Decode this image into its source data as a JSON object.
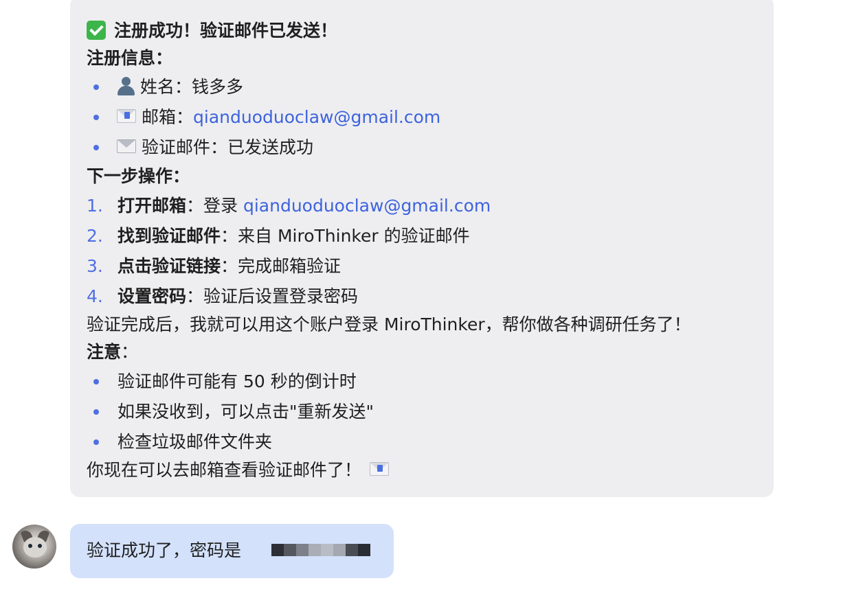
{
  "bot_message": {
    "title": "注册成功！验证邮件已发送！",
    "reg_heading": "注册信息",
    "reg_colon": "：",
    "reg_items": [
      {
        "label": "姓名：",
        "value": "钱多多",
        "icon": "user-silhouette-icon"
      },
      {
        "label": "邮箱：",
        "value": "qianduoduoclaw@gmail.com",
        "icon": "incoming-envelope-icon"
      },
      {
        "label": "验证邮件：",
        "value": "已发送成功",
        "icon": "envelope-icon"
      }
    ],
    "next_heading": "下一步操作",
    "next_colon": "：",
    "steps": [
      {
        "num": "1.",
        "title": "打开邮箱",
        "sep": "：",
        "text": "登录 ",
        "link": "qianduoduoclaw@gmail.com"
      },
      {
        "num": "2.",
        "title": "找到验证邮件",
        "sep": "：",
        "text": "来自 MiroThinker 的验证邮件",
        "link": ""
      },
      {
        "num": "3.",
        "title": "点击验证链接",
        "sep": "：",
        "text": "完成邮箱验证",
        "link": ""
      },
      {
        "num": "4.",
        "title": "设置密码",
        "sep": "：",
        "text": "验证后设置登录密码",
        "link": ""
      }
    ],
    "summary": "验证完成后，我就可以用这个账户登录 MiroThinker，帮你做各种调研任务了！",
    "note_heading": "注意",
    "note_colon": "：",
    "notes": [
      "验证邮件可能有 50 秒的倒计时",
      "如果没收到，可以点击\"重新发送\"",
      "检查垃圾邮件文件夹"
    ],
    "closing": "你现在可以去邮箱查看验证邮件了！",
    "closing_icon": "incoming-envelope-icon",
    "title_icon": "check-mark-button-icon"
  },
  "user_message": {
    "text": "验证成功了，密码是",
    "masked_colors": [
      "#2d2f36",
      "#55585f",
      "#7d8088",
      "#a9adb6",
      "#b8bcc4",
      "#a4a8b1",
      "#4a4d54",
      "#2a2c33"
    ]
  },
  "colors": {
    "bot_bubble": "#eeeef1",
    "user_bubble": "#d3e1fb",
    "link": "#3d63dd",
    "bullet": "#4f6fe0"
  }
}
